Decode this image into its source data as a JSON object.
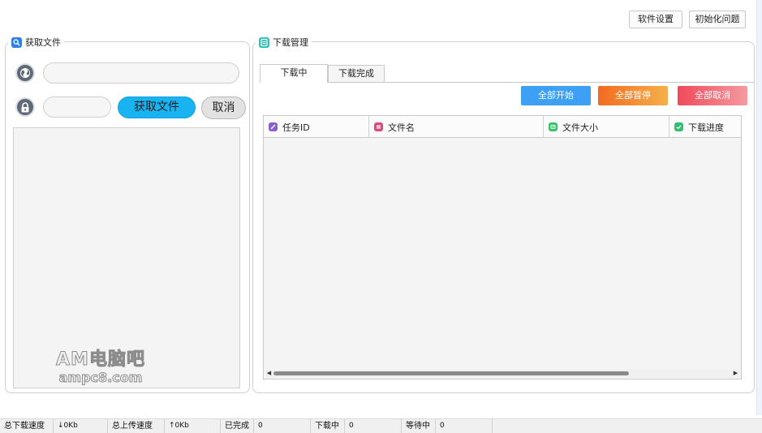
{
  "toolbar": {
    "settings_label": "软件设置",
    "reset_label": "初始化问题"
  },
  "fetch_panel": {
    "title": "获取文件",
    "title_icon": "search-icon",
    "url_icon": "globe-icon",
    "url_value": "",
    "password_icon": "lock-icon",
    "password_value": "",
    "fetch_button": "获取文件",
    "cancel_button": "取消"
  },
  "download_panel": {
    "title": "下载管理",
    "title_icon": "clipboard-icon",
    "tabs": [
      {
        "label": "下载中",
        "active": true
      },
      {
        "label": "下载完成",
        "active": false
      }
    ],
    "actions": {
      "start_all": "全部开始",
      "pause_all": "全部暂停",
      "cancel_all": "全部取消"
    },
    "columns": [
      {
        "label": "任务ID",
        "icon": "edit-icon",
        "color": "#8a5cd6"
      },
      {
        "label": "文件名",
        "icon": "file-icon",
        "color": "#e0457b"
      },
      {
        "label": "文件大小",
        "icon": "size-icon",
        "color": "#3bc46a"
      },
      {
        "label": "下载进度",
        "icon": "check-icon",
        "color": "#2fbf71"
      }
    ],
    "rows": []
  },
  "watermark": {
    "line1": "AM电脑吧",
    "line2": "ampc8.com"
  },
  "statusbar": {
    "download_speed_label": "总下载速度",
    "download_speed_value": "↓0Kb",
    "upload_speed_label": "总上传速度",
    "upload_speed_value": "↑0Kb",
    "completed_label": "已完成",
    "completed_value": "0",
    "downloading_label": "下载中",
    "downloading_value": "0",
    "waiting_label": "等待中",
    "waiting_value": "0"
  }
}
